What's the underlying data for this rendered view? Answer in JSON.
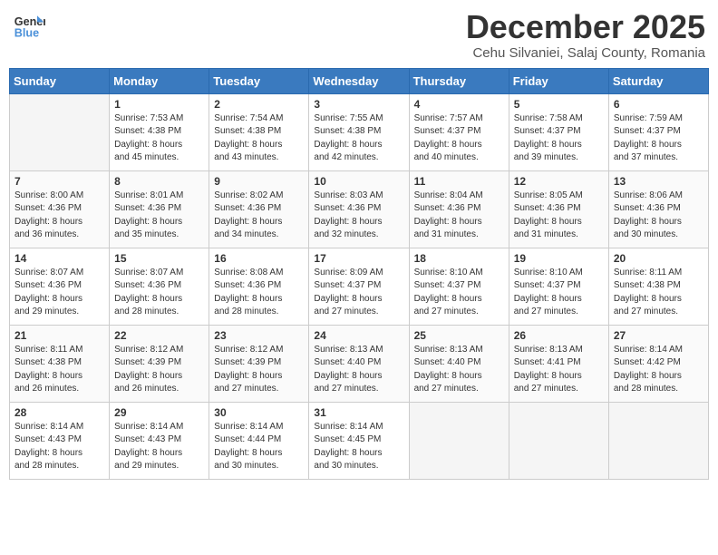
{
  "header": {
    "logo_line1": "General",
    "logo_line2": "Blue",
    "month": "December 2025",
    "location": "Cehu Silvaniei, Salaj County, Romania"
  },
  "weekdays": [
    "Sunday",
    "Monday",
    "Tuesday",
    "Wednesday",
    "Thursday",
    "Friday",
    "Saturday"
  ],
  "weeks": [
    [
      {
        "day": "",
        "info": ""
      },
      {
        "day": "1",
        "info": "Sunrise: 7:53 AM\nSunset: 4:38 PM\nDaylight: 8 hours\nand 45 minutes."
      },
      {
        "day": "2",
        "info": "Sunrise: 7:54 AM\nSunset: 4:38 PM\nDaylight: 8 hours\nand 43 minutes."
      },
      {
        "day": "3",
        "info": "Sunrise: 7:55 AM\nSunset: 4:38 PM\nDaylight: 8 hours\nand 42 minutes."
      },
      {
        "day": "4",
        "info": "Sunrise: 7:57 AM\nSunset: 4:37 PM\nDaylight: 8 hours\nand 40 minutes."
      },
      {
        "day": "5",
        "info": "Sunrise: 7:58 AM\nSunset: 4:37 PM\nDaylight: 8 hours\nand 39 minutes."
      },
      {
        "day": "6",
        "info": "Sunrise: 7:59 AM\nSunset: 4:37 PM\nDaylight: 8 hours\nand 37 minutes."
      }
    ],
    [
      {
        "day": "7",
        "info": "Sunrise: 8:00 AM\nSunset: 4:36 PM\nDaylight: 8 hours\nand 36 minutes."
      },
      {
        "day": "8",
        "info": "Sunrise: 8:01 AM\nSunset: 4:36 PM\nDaylight: 8 hours\nand 35 minutes."
      },
      {
        "day": "9",
        "info": "Sunrise: 8:02 AM\nSunset: 4:36 PM\nDaylight: 8 hours\nand 34 minutes."
      },
      {
        "day": "10",
        "info": "Sunrise: 8:03 AM\nSunset: 4:36 PM\nDaylight: 8 hours\nand 32 minutes."
      },
      {
        "day": "11",
        "info": "Sunrise: 8:04 AM\nSunset: 4:36 PM\nDaylight: 8 hours\nand 31 minutes."
      },
      {
        "day": "12",
        "info": "Sunrise: 8:05 AM\nSunset: 4:36 PM\nDaylight: 8 hours\nand 31 minutes."
      },
      {
        "day": "13",
        "info": "Sunrise: 8:06 AM\nSunset: 4:36 PM\nDaylight: 8 hours\nand 30 minutes."
      }
    ],
    [
      {
        "day": "14",
        "info": "Sunrise: 8:07 AM\nSunset: 4:36 PM\nDaylight: 8 hours\nand 29 minutes."
      },
      {
        "day": "15",
        "info": "Sunrise: 8:07 AM\nSunset: 4:36 PM\nDaylight: 8 hours\nand 28 minutes."
      },
      {
        "day": "16",
        "info": "Sunrise: 8:08 AM\nSunset: 4:36 PM\nDaylight: 8 hours\nand 28 minutes."
      },
      {
        "day": "17",
        "info": "Sunrise: 8:09 AM\nSunset: 4:37 PM\nDaylight: 8 hours\nand 27 minutes."
      },
      {
        "day": "18",
        "info": "Sunrise: 8:10 AM\nSunset: 4:37 PM\nDaylight: 8 hours\nand 27 minutes."
      },
      {
        "day": "19",
        "info": "Sunrise: 8:10 AM\nSunset: 4:37 PM\nDaylight: 8 hours\nand 27 minutes."
      },
      {
        "day": "20",
        "info": "Sunrise: 8:11 AM\nSunset: 4:38 PM\nDaylight: 8 hours\nand 27 minutes."
      }
    ],
    [
      {
        "day": "21",
        "info": "Sunrise: 8:11 AM\nSunset: 4:38 PM\nDaylight: 8 hours\nand 26 minutes."
      },
      {
        "day": "22",
        "info": "Sunrise: 8:12 AM\nSunset: 4:39 PM\nDaylight: 8 hours\nand 26 minutes."
      },
      {
        "day": "23",
        "info": "Sunrise: 8:12 AM\nSunset: 4:39 PM\nDaylight: 8 hours\nand 27 minutes."
      },
      {
        "day": "24",
        "info": "Sunrise: 8:13 AM\nSunset: 4:40 PM\nDaylight: 8 hours\nand 27 minutes."
      },
      {
        "day": "25",
        "info": "Sunrise: 8:13 AM\nSunset: 4:40 PM\nDaylight: 8 hours\nand 27 minutes."
      },
      {
        "day": "26",
        "info": "Sunrise: 8:13 AM\nSunset: 4:41 PM\nDaylight: 8 hours\nand 27 minutes."
      },
      {
        "day": "27",
        "info": "Sunrise: 8:14 AM\nSunset: 4:42 PM\nDaylight: 8 hours\nand 28 minutes."
      }
    ],
    [
      {
        "day": "28",
        "info": "Sunrise: 8:14 AM\nSunset: 4:43 PM\nDaylight: 8 hours\nand 28 minutes."
      },
      {
        "day": "29",
        "info": "Sunrise: 8:14 AM\nSunset: 4:43 PM\nDaylight: 8 hours\nand 29 minutes."
      },
      {
        "day": "30",
        "info": "Sunrise: 8:14 AM\nSunset: 4:44 PM\nDaylight: 8 hours\nand 30 minutes."
      },
      {
        "day": "31",
        "info": "Sunrise: 8:14 AM\nSunset: 4:45 PM\nDaylight: 8 hours\nand 30 minutes."
      },
      {
        "day": "",
        "info": ""
      },
      {
        "day": "",
        "info": ""
      },
      {
        "day": "",
        "info": ""
      }
    ]
  ]
}
